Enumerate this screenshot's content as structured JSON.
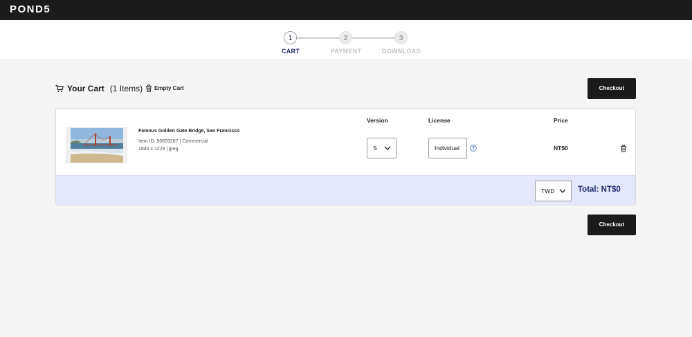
{
  "brand": {
    "logo_text": "POND5"
  },
  "steps": [
    {
      "number": "1",
      "label": "CART",
      "active": true
    },
    {
      "number": "2",
      "label": "PAYMENT",
      "active": false
    },
    {
      "number": "3",
      "label": "DOWNLOAD",
      "active": false
    }
  ],
  "cart": {
    "title": "Your Cart",
    "count_text": "(1 Items)",
    "empty_label": "Empty Cart",
    "checkout_label": "Checkout"
  },
  "table": {
    "headers": {
      "version": "Version",
      "license": "License",
      "price": "Price"
    }
  },
  "item": {
    "title": "Famous Golden Gate Bridge, San Francisco",
    "id_line": "Item ID: 50659287 | Commercial",
    "meta_line": "1840 x 1228 | jpeg",
    "version_value": "S",
    "license_value": "Individual",
    "price": "NT$0"
  },
  "totals": {
    "currency_value": "TWD",
    "total_text": "Total: NT$0"
  },
  "colors": {
    "accent": "#1f2a6e",
    "topbar": "#1b1b1b",
    "totals_bg": "#e5e8fb"
  },
  "icons": [
    "cart-icon",
    "trash-icon",
    "chevron-down-icon",
    "help-icon"
  ]
}
